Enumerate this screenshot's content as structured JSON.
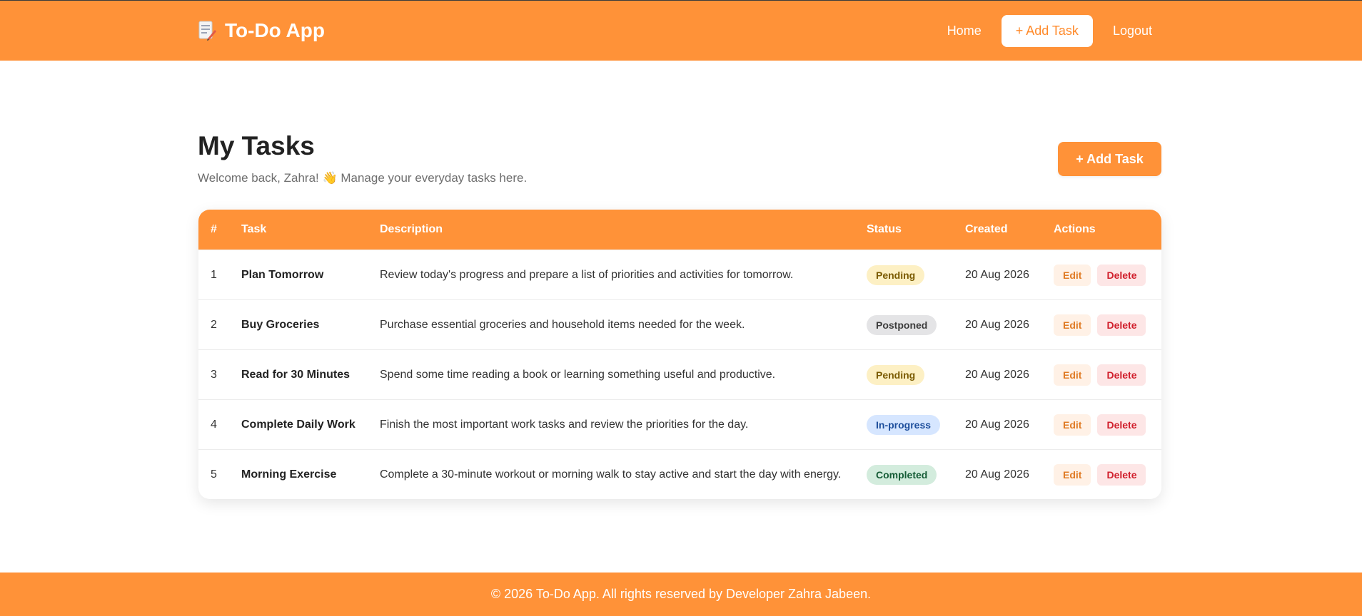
{
  "nav": {
    "brand": "To-Do App",
    "brand_icon": "memo-icon",
    "links": {
      "home": "Home",
      "add_task": "+ Add Task",
      "logout": "Logout"
    }
  },
  "header": {
    "title": "My Tasks",
    "subtitle": "Welcome back, Zahra! 👋 Manage your everyday tasks here.",
    "add_button": "+ Add Task"
  },
  "table": {
    "columns": [
      "#",
      "Task",
      "Description",
      "Status",
      "Created",
      "Actions"
    ],
    "rows": [
      {
        "num": "1",
        "task": "Plan Tomorrow",
        "description": "Review today's progress and prepare a list of priorities and activities for tomorrow.",
        "status": "Pending",
        "status_bg": "#fdf0c4",
        "status_fg": "#7a5a00",
        "created": "20 Aug 2026",
        "edit": "Edit",
        "delete": "Delete"
      },
      {
        "num": "2",
        "task": "Buy Groceries",
        "description": "Purchase essential groceries and household items needed for the week.",
        "status": "Postponed",
        "status_bg": "#e4e4e6",
        "status_fg": "#3c3c3c",
        "created": "20 Aug 2026",
        "edit": "Edit",
        "delete": "Delete"
      },
      {
        "num": "3",
        "task": "Read for 30 Minutes",
        "description": "Spend some time reading a book or learning something useful and productive.",
        "status": "Pending",
        "status_bg": "#fdf0c4",
        "status_fg": "#7a5a00",
        "created": "20 Aug 2026",
        "edit": "Edit",
        "delete": "Delete"
      },
      {
        "num": "4",
        "task": "Complete Daily Work",
        "description": "Finish the most important work tasks and review the priorities for the day.",
        "status": "In-progress",
        "status_bg": "#d6e6ff",
        "status_fg": "#1d4e9c",
        "created": "20 Aug 2026",
        "edit": "Edit",
        "delete": "Delete"
      },
      {
        "num": "5",
        "task": "Morning Exercise",
        "description": "Complete a 30-minute workout or morning walk to stay active and start the day with energy.",
        "status": "Completed",
        "status_bg": "#d3ecdd",
        "status_fg": "#155c36",
        "created": "20 Aug 2026",
        "edit": "Edit",
        "delete": "Delete"
      }
    ]
  },
  "footer": {
    "text": "© 2026 To-Do App. All rights reserved by Developer Zahra Jabeen."
  },
  "colors": {
    "accent": "#ff9238",
    "edit": "#e07a24",
    "delete": "#d1202d"
  }
}
